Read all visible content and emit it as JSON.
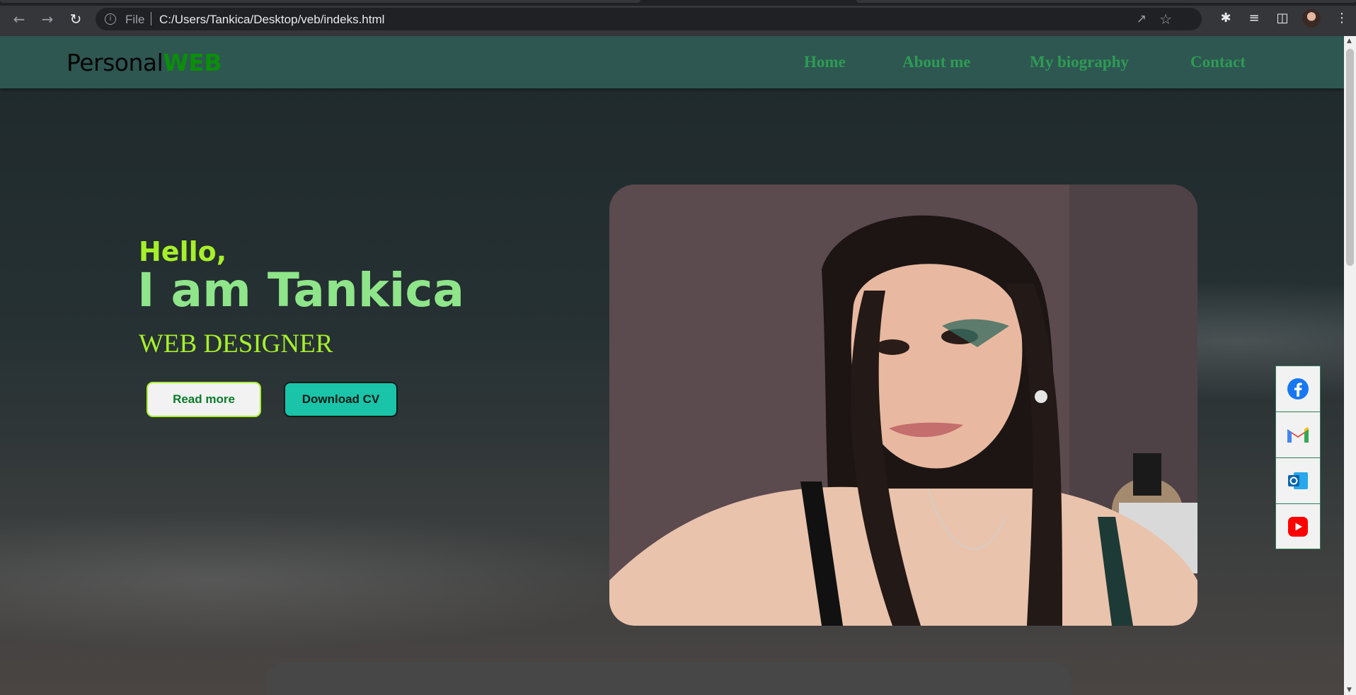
{
  "browser": {
    "url_scheme_label": "File",
    "url": "C:/Users/Tankica/Desktop/veb/indeks.html",
    "icons": [
      "back-icon",
      "forward-icon",
      "reload-icon",
      "info-icon",
      "share-icon",
      "star-icon",
      "extensions-icon",
      "reading-list-icon",
      "side-panel-icon",
      "profile-avatar",
      "menu-icon"
    ]
  },
  "site": {
    "logo": {
      "part1": "Personal",
      "part2": "WEB"
    },
    "nav": [
      "Home",
      "About me",
      "My biography",
      "Contact"
    ]
  },
  "hero": {
    "greeting": "Hello,",
    "name": "I am Tankica",
    "role": "WEB DESIGNER",
    "buttons": {
      "read_more": "Read more",
      "download_cv": "Download CV"
    }
  },
  "social": [
    "facebook-icon",
    "gmail-icon",
    "outlook-icon",
    "youtube-icon"
  ],
  "colors": {
    "header_bg": "#2e5751",
    "nav_text": "#2e9b55",
    "accent_lime": "#a6f02a",
    "accent_green": "#8fe58a",
    "cv_button": "#19c4a9"
  }
}
